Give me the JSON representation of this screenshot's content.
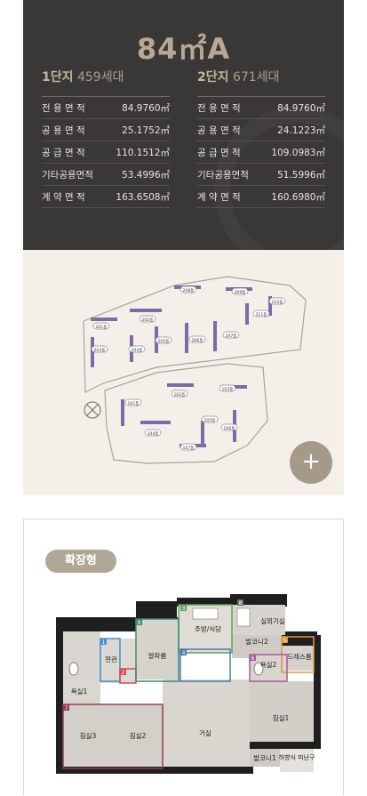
{
  "unit_type": "84㎡A",
  "complex1": {
    "name": "1단지",
    "units": "459세대",
    "rows": [
      {
        "label": "전 용 면 적",
        "value": "84.9760㎡"
      },
      {
        "label": "공 용 면 적",
        "value": "25.1752㎡"
      },
      {
        "label": "공 급 면 적",
        "value": "110.1512㎡"
      },
      {
        "label": "기타공용면적",
        "value": "53.4996㎡"
      },
      {
        "label": "계 약 면 적",
        "value": "163.6508㎡"
      }
    ]
  },
  "complex2": {
    "name": "2단지",
    "units": "671세대",
    "rows": [
      {
        "label": "전 용 면 적",
        "value": "84.9760㎡"
      },
      {
        "label": "공 용 면 적",
        "value": "24.1223㎡"
      },
      {
        "label": "공 급 면 적",
        "value": "109.0983㎡"
      },
      {
        "label": "기타공용면적",
        "value": "51.5996㎡"
      },
      {
        "label": "계 약 면 적",
        "value": "160.6980㎡"
      }
    ]
  },
  "site_map": {
    "zoom_label": "+",
    "buildings": [
      "208동",
      "209동",
      "210동",
      "211동",
      "201동",
      "202동",
      "203동",
      "204동",
      "205동",
      "206동",
      "207동",
      "101동",
      "102동",
      "103동",
      "104동",
      "105동",
      "106동",
      "107동"
    ]
  },
  "plan": {
    "badge": "확장형",
    "rooms": {
      "outdoor": "실외기실",
      "kitchen": "주방/식당",
      "balcony2": "발코니2",
      "dress": "드레스룸",
      "entrance": "현관",
      "alpha": "알파룸",
      "bath2": "욕실2",
      "bath1": "욕실1",
      "bed3": "침실3",
      "bed2": "침실2",
      "living": "거실",
      "bed1": "침실1",
      "balcony1": "발코니1",
      "evac": "하향식 피난구"
    },
    "markers": [
      "1",
      "2",
      "3",
      "4",
      "5",
      "6",
      "7",
      "8",
      "9"
    ]
  }
}
